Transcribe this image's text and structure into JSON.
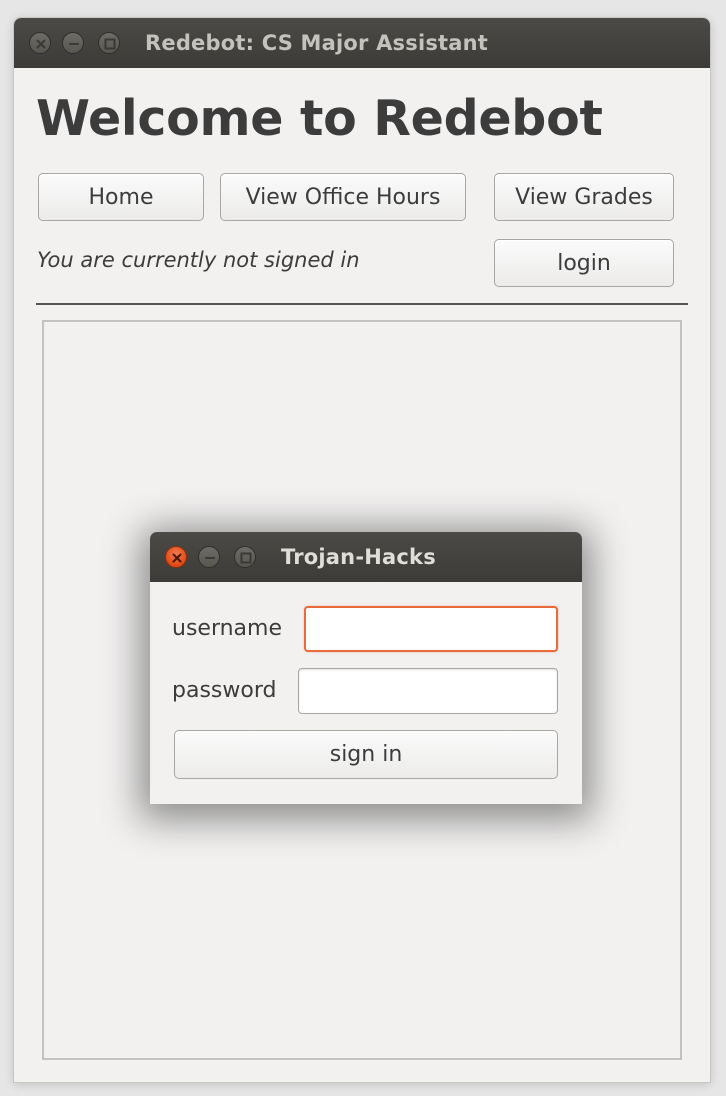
{
  "main_window": {
    "title": "Redebot: CS Major Assistant",
    "heading": "Welcome to Redebot",
    "nav": {
      "home_label": "Home",
      "office_hours_label": "View Office Hours",
      "grades_label": "View Grades"
    },
    "status_text": "You are currently not signed in",
    "login_label": "login"
  },
  "dialog": {
    "title": "Trojan-Hacks",
    "username_label": "username",
    "username_value": "",
    "password_label": "password",
    "password_value": "",
    "sign_in_label": "sign in"
  },
  "colors": {
    "titlebar": "#3c3b37",
    "window_bg": "#f2f1f0",
    "focus_accent": "#e86b3c",
    "close_active": "#df4a16"
  }
}
